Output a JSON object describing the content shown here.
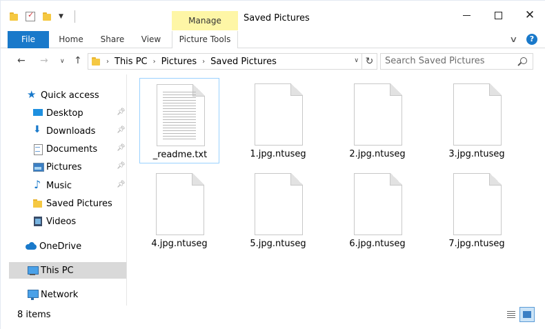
{
  "window": {
    "title": "Saved Pictures",
    "context_tab_group": "Manage"
  },
  "ribbon": {
    "tabs": [
      "File",
      "Home",
      "Share",
      "View",
      "Picture Tools"
    ],
    "help_label": "?"
  },
  "address": {
    "breadcrumbs": [
      "This PC",
      "Pictures",
      "Saved Pictures"
    ],
    "search_placeholder": "Search Saved Pictures"
  },
  "sidebar": {
    "quick_access": "Quick access",
    "items": [
      {
        "label": "Desktop",
        "pinned": true
      },
      {
        "label": "Downloads",
        "pinned": true
      },
      {
        "label": "Documents",
        "pinned": true
      },
      {
        "label": "Pictures",
        "pinned": true
      },
      {
        "label": "Music",
        "pinned": true
      },
      {
        "label": "Saved Pictures",
        "pinned": false
      },
      {
        "label": "Videos",
        "pinned": false
      }
    ],
    "onedrive": "OneDrive",
    "this_pc": "This PC",
    "network": "Network"
  },
  "files": [
    {
      "name": "_readme.txt",
      "type": "text"
    },
    {
      "name": "1.jpg.ntuseg",
      "type": "blank"
    },
    {
      "name": "2.jpg.ntuseg",
      "type": "blank"
    },
    {
      "name": "3.jpg.ntuseg",
      "type": "blank"
    },
    {
      "name": "4.jpg.ntuseg",
      "type": "blank"
    },
    {
      "name": "5.jpg.ntuseg",
      "type": "blank"
    },
    {
      "name": "6.jpg.ntuseg",
      "type": "blank"
    },
    {
      "name": "7.jpg.ntuseg",
      "type": "blank"
    }
  ],
  "status": {
    "item_count": "8 items"
  },
  "colors": {
    "accent": "#1979ca",
    "manage_tab": "#fef6a6",
    "selection_border": "#99d1ff",
    "folder": "#f5c842"
  }
}
